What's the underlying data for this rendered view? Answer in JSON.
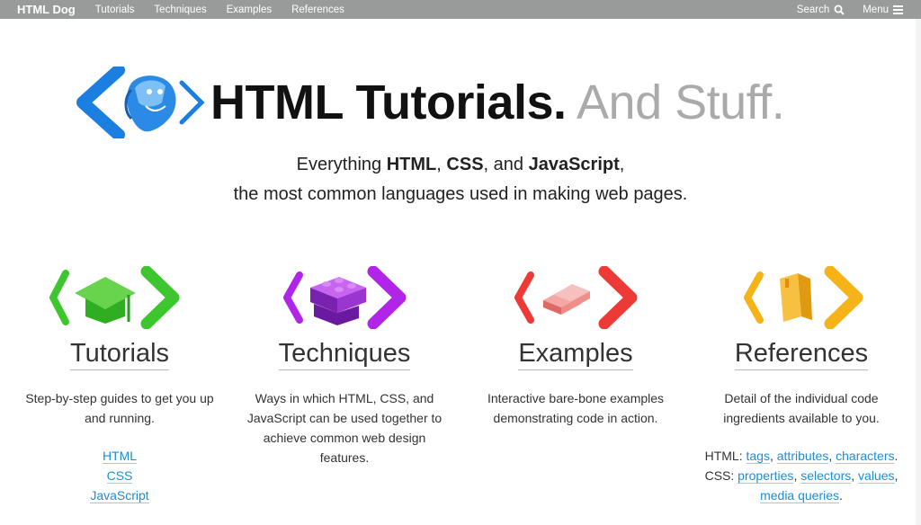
{
  "nav": {
    "brand": "HTML Dog",
    "links": [
      "Tutorials",
      "Techniques",
      "Examples",
      "References"
    ],
    "search_label": "Search",
    "menu_label": "Menu"
  },
  "hero": {
    "title_bold": "HTML Tutorials.",
    "title_light": "And Stuff."
  },
  "intro": {
    "prefix": "Everything ",
    "html": "HTML",
    "comma1": ", ",
    "css": "CSS",
    "and": ", and ",
    "js": "JavaScript",
    "comma2": ",",
    "line2": "the most common languages used in making web pages."
  },
  "sections": [
    {
      "title": "Tutorials",
      "description": "Step-by-step guides to get you up and running.",
      "links": [
        "HTML",
        "CSS",
        "JavaScript"
      ]
    },
    {
      "title": "Techniques",
      "description": "Ways in which HTML, CSS, and JavaScript can be used together to achieve common web design features."
    },
    {
      "title": "Examples",
      "description": "Interactive bare-bone examples demonstrating code in action."
    },
    {
      "title": "References",
      "description": "Detail of the individual code ingredients available to you.",
      "html_label": "HTML: ",
      "html_links": [
        "tags",
        "attributes",
        "characters"
      ],
      "css_label": "CSS: ",
      "css_links": [
        "properties",
        "selectors",
        "values",
        "media queries"
      ]
    }
  ],
  "colors": {
    "navbar": "#999a9a",
    "blue": "#1a7fe0",
    "green": "#3ec62e",
    "purple": "#b025e8",
    "red": "#ee3a36",
    "orange": "#f5b318",
    "link": "#1a8fd8"
  },
  "icons": {
    "logo": "dog-logo-icon",
    "tutorials": "graduation-cap-icon",
    "techniques": "lego-brick-icon",
    "examples": "stacked-blocks-icon",
    "references": "book-icon"
  }
}
